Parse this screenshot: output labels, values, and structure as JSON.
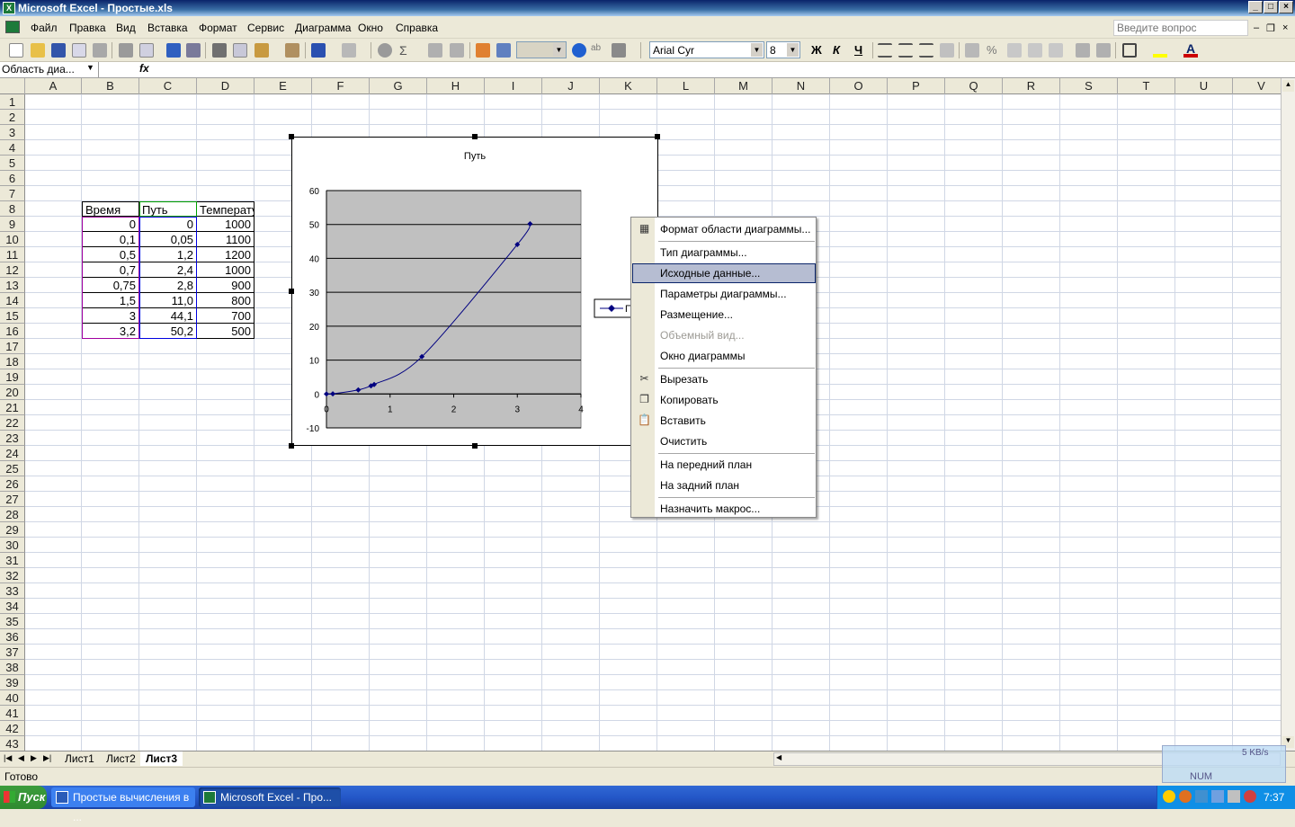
{
  "window": {
    "title": "Microsoft Excel - Простые.xls",
    "app_icon": "excel-icon"
  },
  "menu": {
    "items": [
      "Файл",
      "Правка",
      "Вид",
      "Вставка",
      "Формат",
      "Сервис",
      "Диаграмма",
      "Окно",
      "Справка"
    ],
    "help_placeholder": "Введите вопрос"
  },
  "toolbar": {
    "font_name": "Arial Cyr",
    "font_size": "8",
    "bold_label": "Ж",
    "italic_label": "К",
    "underline_label": "Ч",
    "percent_label": "%",
    "font_color": "#cc0000",
    "fill_color": "#ffff00"
  },
  "formula_bar": {
    "name_box": "Область диа...",
    "fx_label": "fx",
    "value": ""
  },
  "grid": {
    "columns": [
      "A",
      "B",
      "C",
      "D",
      "E",
      "F",
      "G",
      "H",
      "I",
      "J",
      "K",
      "L",
      "M",
      "N",
      "O",
      "P",
      "Q",
      "R",
      "S",
      "T",
      "U",
      "V"
    ],
    "rows": [
      "1",
      "2",
      "3",
      "4",
      "5",
      "6",
      "7",
      "8",
      "9",
      "10",
      "11",
      "12",
      "13",
      "14",
      "15",
      "16",
      "17",
      "18",
      "19",
      "20",
      "21",
      "22",
      "23",
      "24",
      "25",
      "26",
      "27",
      "28",
      "29",
      "30",
      "31",
      "32",
      "33",
      "34",
      "35",
      "36",
      "37",
      "38",
      "39",
      "40",
      "41",
      "42",
      "43"
    ]
  },
  "table": {
    "headers": [
      "Время",
      "Путь",
      "Температура"
    ],
    "rows": [
      [
        "0",
        "0",
        "1000"
      ],
      [
        "0,1",
        "0,05",
        "1100"
      ],
      [
        "0,5",
        "1,2",
        "1200"
      ],
      [
        "0,7",
        "2,4",
        "1000"
      ],
      [
        "0,75",
        "2,8",
        "900"
      ],
      [
        "1,5",
        "11,0",
        "800"
      ],
      [
        "3",
        "44,1",
        "700"
      ],
      [
        "3,2",
        "50,2",
        "500"
      ]
    ]
  },
  "chart_data": {
    "type": "scatter",
    "title": "Путь",
    "series": [
      {
        "name": "Путь",
        "x": [
          0,
          0.1,
          0.5,
          0.7,
          0.75,
          1.5,
          3,
          3.2
        ],
        "y": [
          0,
          0.05,
          1.2,
          2.4,
          2.8,
          11.0,
          44.1,
          50.2
        ],
        "smooth": true,
        "color": "#000080"
      }
    ],
    "xlim": [
      0,
      4
    ],
    "ylim": [
      -10,
      60
    ],
    "x_ticks": [
      "0",
      "1",
      "2",
      "3",
      "4"
    ],
    "y_ticks": [
      "-10",
      "0",
      "10",
      "20",
      "30",
      "40",
      "50",
      "60"
    ],
    "legend_label": "П",
    "legend_position": "right",
    "grid": "horizontal major",
    "plot_background": "#c0c0c0"
  },
  "context_menu": {
    "items": [
      {
        "label": "Формат области диаграммы...",
        "icon": "format-chart-area-icon",
        "state": "normal"
      },
      {
        "label": "Тип диаграммы...",
        "icon": "",
        "state": "normal"
      },
      {
        "label": "Исходные данные...",
        "icon": "",
        "state": "highlighted"
      },
      {
        "label": "Параметры диаграммы...",
        "icon": "",
        "state": "normal"
      },
      {
        "label": "Размещение...",
        "icon": "",
        "state": "normal"
      },
      {
        "label": "Объемный вид...",
        "icon": "",
        "state": "disabled"
      },
      {
        "label": "Окно диаграммы",
        "icon": "",
        "state": "normal"
      },
      {
        "label": "Вырезать",
        "icon": "scissors-icon",
        "state": "normal"
      },
      {
        "label": "Копировать",
        "icon": "copy-icon",
        "state": "normal"
      },
      {
        "label": "Вставить",
        "icon": "paste-icon",
        "state": "normal"
      },
      {
        "label": "Очистить",
        "icon": "",
        "state": "normal"
      },
      {
        "label": "На передний план",
        "icon": "",
        "state": "normal"
      },
      {
        "label": "На задний план",
        "icon": "",
        "state": "normal"
      },
      {
        "label": "Назначить макрос...",
        "icon": "",
        "state": "normal"
      }
    ]
  },
  "sheets": {
    "tabs": [
      "Лист1",
      "Лист2",
      "Лист3"
    ],
    "active": "Лист3"
  },
  "status": {
    "text": "Готово",
    "num": "NUM",
    "net_speed": "5 KB/s"
  },
  "taskbar": {
    "start": "Пуск",
    "tasks": [
      "Простые вычисления в ...",
      "Microsoft Excel - Про..."
    ],
    "clock": "7:37"
  }
}
